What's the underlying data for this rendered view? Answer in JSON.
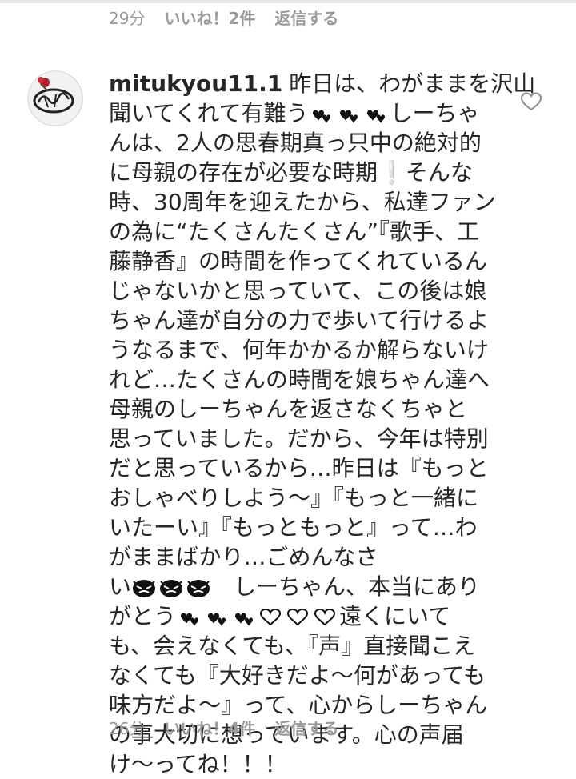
{
  "previous_comment": {
    "age": "29分",
    "likes": "いいね！2件",
    "reply": "返信する"
  },
  "comment": {
    "username": "mitukyou11.1",
    "lines": [
      "昨日は、わがままを沢山",
      "聞いてくれて有難う",
      "しーちゃ",
      "んは、2人の思春期真っ只中の絶対的",
      "に母親の存在が必要な時期❕そんな",
      "時、30周年を迎えたから、私達ファン",
      "の為に“たくさんたくさん”『歌手、工",
      "藤静香』の時間を作ってくれているん",
      "じゃないかと思っていて、この後は娘",
      "ちゃん達が自分の力で歩いて行けるよ",
      "うなるまで、何年かかるか解らないけ",
      "れど…たくさんの時間を娘ちゃん達へ",
      "母親のしーちゃんを返さなくちゃと",
      "思っていました。だから、今年は特別",
      "だと思っているから…昨日は『もっと",
      "おしゃべりしよう～』『もっと一緒に",
      "いたーい』『もっともっと』って…わ",
      "がままばかり…ごめんなさ",
      "い",
      "しーちゃん、本当にあり",
      "がとう",
      "遠くにいて",
      "も、会えなくても、『声』直接聞こえ",
      "なくても『大好きだよ～何があっても",
      "味方だよ～』って、心からしーちゃん",
      "の事大切に想っています。心の声届",
      "け～ってね！！！"
    ],
    "emoji_names": [
      "two-hearts-icon",
      "crying-face-icon",
      "white-heart-icon"
    ],
    "stats": {
      "age": "26分",
      "likes": "いいね！4件",
      "reply": "返信する"
    }
  }
}
